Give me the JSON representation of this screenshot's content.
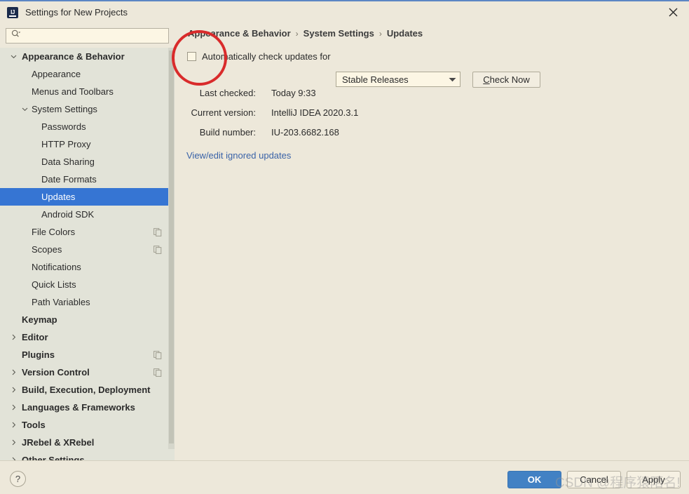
{
  "window": {
    "title": "Settings for New Projects",
    "app_icon": "intellij-idea-icon",
    "close_icon": "close-icon"
  },
  "search": {
    "value": "",
    "placeholder": "",
    "icon": "search-icon"
  },
  "sidebar": {
    "items": [
      {
        "label": "Appearance & Behavior",
        "level": 0,
        "expanded": true,
        "arrow": "chevron-down",
        "bold": true,
        "selected": false,
        "copy_icon": false
      },
      {
        "label": "Appearance",
        "level": 1,
        "expanded": null,
        "arrow": "",
        "bold": false,
        "selected": false,
        "copy_icon": false
      },
      {
        "label": "Menus and Toolbars",
        "level": 1,
        "expanded": null,
        "arrow": "",
        "bold": false,
        "selected": false,
        "copy_icon": false
      },
      {
        "label": "System Settings",
        "level": 1,
        "expanded": true,
        "arrow": "chevron-down",
        "bold": false,
        "selected": false,
        "copy_icon": false
      },
      {
        "label": "Passwords",
        "level": 2,
        "expanded": null,
        "arrow": "",
        "bold": false,
        "selected": false,
        "copy_icon": false
      },
      {
        "label": "HTTP Proxy",
        "level": 2,
        "expanded": null,
        "arrow": "",
        "bold": false,
        "selected": false,
        "copy_icon": false
      },
      {
        "label": "Data Sharing",
        "level": 2,
        "expanded": null,
        "arrow": "",
        "bold": false,
        "selected": false,
        "copy_icon": false
      },
      {
        "label": "Date Formats",
        "level": 2,
        "expanded": null,
        "arrow": "",
        "bold": false,
        "selected": false,
        "copy_icon": false
      },
      {
        "label": "Updates",
        "level": 2,
        "expanded": null,
        "arrow": "",
        "bold": false,
        "selected": true,
        "copy_icon": false
      },
      {
        "label": "Android SDK",
        "level": 2,
        "expanded": null,
        "arrow": "",
        "bold": false,
        "selected": false,
        "copy_icon": false
      },
      {
        "label": "File Colors",
        "level": 1,
        "expanded": null,
        "arrow": "",
        "bold": false,
        "selected": false,
        "copy_icon": true
      },
      {
        "label": "Scopes",
        "level": 1,
        "expanded": null,
        "arrow": "",
        "bold": false,
        "selected": false,
        "copy_icon": true
      },
      {
        "label": "Notifications",
        "level": 1,
        "expanded": null,
        "arrow": "",
        "bold": false,
        "selected": false,
        "copy_icon": false
      },
      {
        "label": "Quick Lists",
        "level": 1,
        "expanded": null,
        "arrow": "",
        "bold": false,
        "selected": false,
        "copy_icon": false
      },
      {
        "label": "Path Variables",
        "level": 1,
        "expanded": null,
        "arrow": "",
        "bold": false,
        "selected": false,
        "copy_icon": false
      },
      {
        "label": "Keymap",
        "level": 0,
        "expanded": null,
        "arrow": "",
        "bold": true,
        "selected": false,
        "copy_icon": false
      },
      {
        "label": "Editor",
        "level": 0,
        "expanded": false,
        "arrow": "chevron-right",
        "bold": true,
        "selected": false,
        "copy_icon": false
      },
      {
        "label": "Plugins",
        "level": 0,
        "expanded": null,
        "arrow": "",
        "bold": true,
        "selected": false,
        "copy_icon": true
      },
      {
        "label": "Version Control",
        "level": 0,
        "expanded": false,
        "arrow": "chevron-right",
        "bold": true,
        "selected": false,
        "copy_icon": true
      },
      {
        "label": "Build, Execution, Deployment",
        "level": 0,
        "expanded": false,
        "arrow": "chevron-right",
        "bold": true,
        "selected": false,
        "copy_icon": false
      },
      {
        "label": "Languages & Frameworks",
        "level": 0,
        "expanded": false,
        "arrow": "chevron-right",
        "bold": true,
        "selected": false,
        "copy_icon": false
      },
      {
        "label": "Tools",
        "level": 0,
        "expanded": false,
        "arrow": "chevron-right",
        "bold": true,
        "selected": false,
        "copy_icon": false
      },
      {
        "label": "JRebel & XRebel",
        "level": 0,
        "expanded": false,
        "arrow": "chevron-right",
        "bold": true,
        "selected": false,
        "copy_icon": false
      },
      {
        "label": "Other Settings",
        "level": 0,
        "expanded": false,
        "arrow": "chevron-right",
        "bold": true,
        "selected": false,
        "copy_icon": false
      }
    ]
  },
  "content": {
    "breadcrumb": [
      "Appearance & Behavior",
      "System Settings",
      "Updates"
    ],
    "breadcrumb_separator": "›",
    "auto_check": {
      "label": "Automatically check updates for",
      "checked": false
    },
    "channel": {
      "selected": "Stable Releases",
      "arrow_icon": "chevron-down-icon"
    },
    "check_now_button": {
      "mnemonic": "C",
      "rest": "heck Now"
    },
    "info": [
      {
        "key": "Last checked:",
        "value": "Today 9:33"
      },
      {
        "key": "Current version:",
        "value": "IntelliJ IDEA 2020.3.1"
      },
      {
        "key": "Build number:",
        "value": "IU-203.6682.168"
      }
    ],
    "ignored_updates_link": "View/edit ignored updates"
  },
  "footer": {
    "help_label": "?",
    "buttons": [
      {
        "label": "OK",
        "style": "primary"
      },
      {
        "label": "Cancel",
        "style": "default"
      },
      {
        "label": "Apply",
        "style": "default"
      }
    ]
  },
  "annotation": {
    "shape": "red-circle-highlight",
    "color": "#D92B2B"
  },
  "watermark": {
    "text": "CSDN @程序猿陌名!"
  },
  "colors": {
    "sidebar_bg": "#E2E3D8",
    "content_bg": "#EDE8DA",
    "selection": "#3675D3",
    "link": "#3A63A8",
    "primary_button": "#4281C4"
  }
}
